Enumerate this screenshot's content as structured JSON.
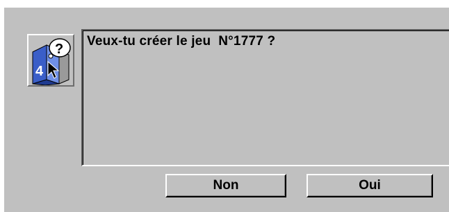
{
  "dialog": {
    "icon": "question-book-cursor-icon",
    "message": "Veux-tu créer le jeu  N°1777 ?",
    "buttons": {
      "no_label": "Non",
      "yes_label": "Oui"
    }
  },
  "colors": {
    "face": "#c0c0c0",
    "highlight": "#ffffff",
    "shadow": "#808080",
    "dark_shadow": "#000000",
    "book_blue": "#3a5ec8"
  }
}
